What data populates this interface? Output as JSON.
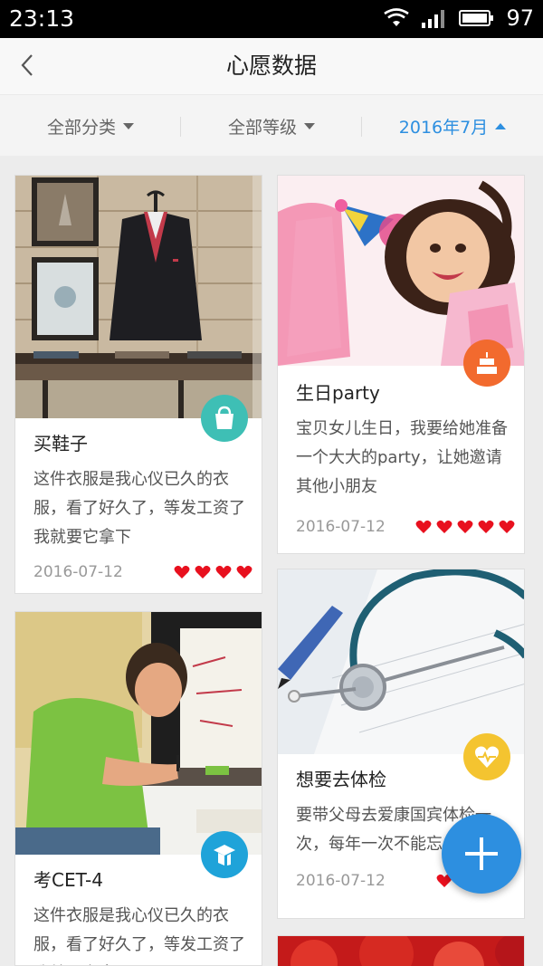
{
  "status_bar": {
    "time": "23:13",
    "battery": "97"
  },
  "header": {
    "title": "心愿数据"
  },
  "filters": {
    "category": "全部分类",
    "level": "全部等级",
    "month": "2016年7月"
  },
  "colors": {
    "accent": "#2d8fe0",
    "heart": "#e8101e"
  },
  "cards": [
    {
      "title": "买鞋子",
      "desc": "这件衣服是我心仪已久的衣服，看了好久了，等发工资了我就要它拿下",
      "date": "2016-07-12",
      "hearts": 4,
      "badge_icon": "shopping-bag-icon",
      "badge_color": "#3ebfb5"
    },
    {
      "title": "生日party",
      "desc": "宝贝女儿生日，我要给她准备一个大大的party，让她邀请其他小朋友",
      "date": "2016-07-12",
      "hearts": 5,
      "badge_icon": "cake-icon",
      "badge_color": "#f26a2e"
    },
    {
      "title": "考CET-4",
      "desc": "这件衣服是我心仪已久的衣服，看了好久了，等发工资了我就要它拿下",
      "date": "",
      "hearts": 0,
      "badge_icon": "study-icon",
      "badge_color": "#1fa3d9"
    },
    {
      "title": "想要去体检",
      "desc": "要带父母去爱康国宾体检一次，每年一次不能忘",
      "date": "2016-07-12",
      "hearts": 1,
      "badge_icon": "heart-pulse-icon",
      "badge_color": "#f4c430"
    }
  ],
  "fab": {
    "icon": "plus-icon"
  }
}
